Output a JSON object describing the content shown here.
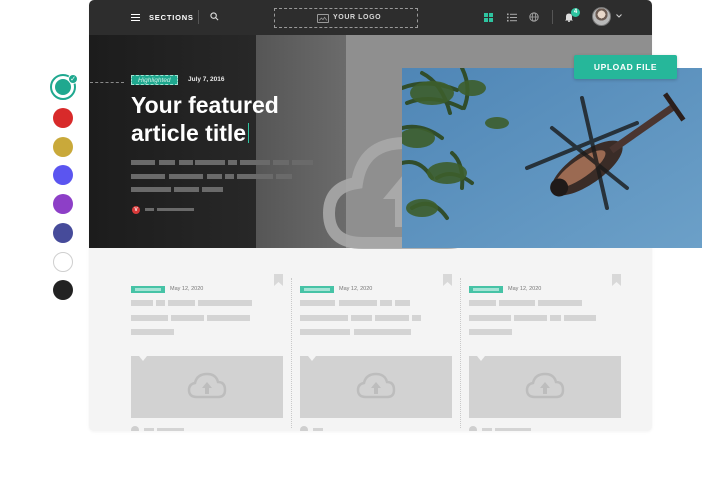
{
  "header": {
    "sections_label": "SECTIONS",
    "logo_text": "YOUR LOGO",
    "notification_count": "4",
    "icons": [
      "menu-icon",
      "search-icon",
      "image-icon",
      "grid-view-icon",
      "list-view-icon",
      "globe-icon",
      "bell-icon",
      "chevron-down-icon"
    ]
  },
  "swatches": {
    "colors": [
      "#1fa88f",
      "#d82a2a",
      "#c9a93a",
      "#5b55f0",
      "#8d3fc7",
      "#464b9a",
      "#ffffff",
      "#222222"
    ],
    "selected_index": 0
  },
  "hero": {
    "tag": "Highlighted",
    "date": "July 7, 2016",
    "title_line1": "Your featured",
    "title_line2": "article title",
    "author_icon": "V"
  },
  "cards": [
    {
      "date": "May 12, 2020"
    },
    {
      "date": "May 12, 2020"
    },
    {
      "date": "May 12, 2020"
    }
  ],
  "upload_button": "UPLOAD FILE",
  "colors": {
    "accent": "#26b79a",
    "topbar": "#2d2d2d",
    "hero_dark": "#1c1c1c",
    "card_placeholder": "#d2d2d2"
  }
}
